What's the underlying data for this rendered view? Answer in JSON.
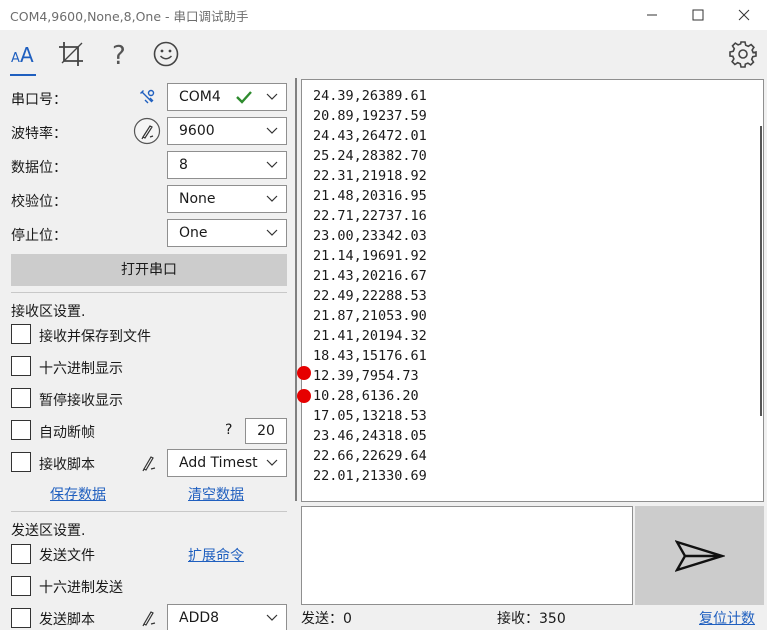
{
  "window": {
    "title": "COM4,9600,None,8,One - 串口调试助手"
  },
  "toolbar": {
    "icons": [
      "font-size-icon",
      "crop-icon",
      "help-icon",
      "smiley-icon",
      "settings-gear-icon"
    ],
    "help_glyph": "?"
  },
  "serial": {
    "port_label": "串口号：",
    "port_value": "COM4",
    "baud_label": "波特率：",
    "baud_value": "9600",
    "databits_label": "数据位：",
    "databits_value": "8",
    "parity_label": "校验位：",
    "parity_value": "None",
    "stopbits_label": "停止位：",
    "stopbits_value": "One",
    "open_button": "打开串口"
  },
  "receive_settings": {
    "header": "接收区设置.",
    "save_to_file": "接收并保存到文件",
    "hex_display": "十六进制显示",
    "pause_display": "暂停接收显示",
    "auto_frame": "自动断帧",
    "auto_frame_help": "?",
    "auto_frame_value": "20",
    "script_label": "接收脚本",
    "script_value": "Add Timest",
    "save_data": "保存数据",
    "clear_data": "清空数据"
  },
  "send_settings": {
    "header": "发送区设置.",
    "send_file": "发送文件",
    "extend_cmd": "扩展命令",
    "hex_send": "十六进制发送",
    "script_label": "发送脚本",
    "script_value": "ADD8"
  },
  "receive_data": {
    "lines": [
      "24.39,26389.61",
      "20.89,19237.59",
      "24.43,26472.01",
      "25.24,28382.70",
      "22.31,21918.92",
      "21.48,20316.95",
      "22.71,22737.16",
      "23.00,23342.03",
      "21.14,19691.92",
      "21.43,20216.67",
      "22.49,22288.53",
      "21.87,21053.90",
      "21.41,20194.32",
      "18.43,15176.61",
      "12.39,7954.73",
      "10.28,6136.20",
      "17.05,13218.53",
      "23.46,24318.05",
      "22.66,22629.64",
      "22.01,21330.69"
    ]
  },
  "status_bar": {
    "sent": "发送：0",
    "received": "接收：350",
    "reset": "复位计数"
  },
  "colors": {
    "accent": "#1f5fbf",
    "marker": "#e60000",
    "check": "#2e8b2e"
  }
}
